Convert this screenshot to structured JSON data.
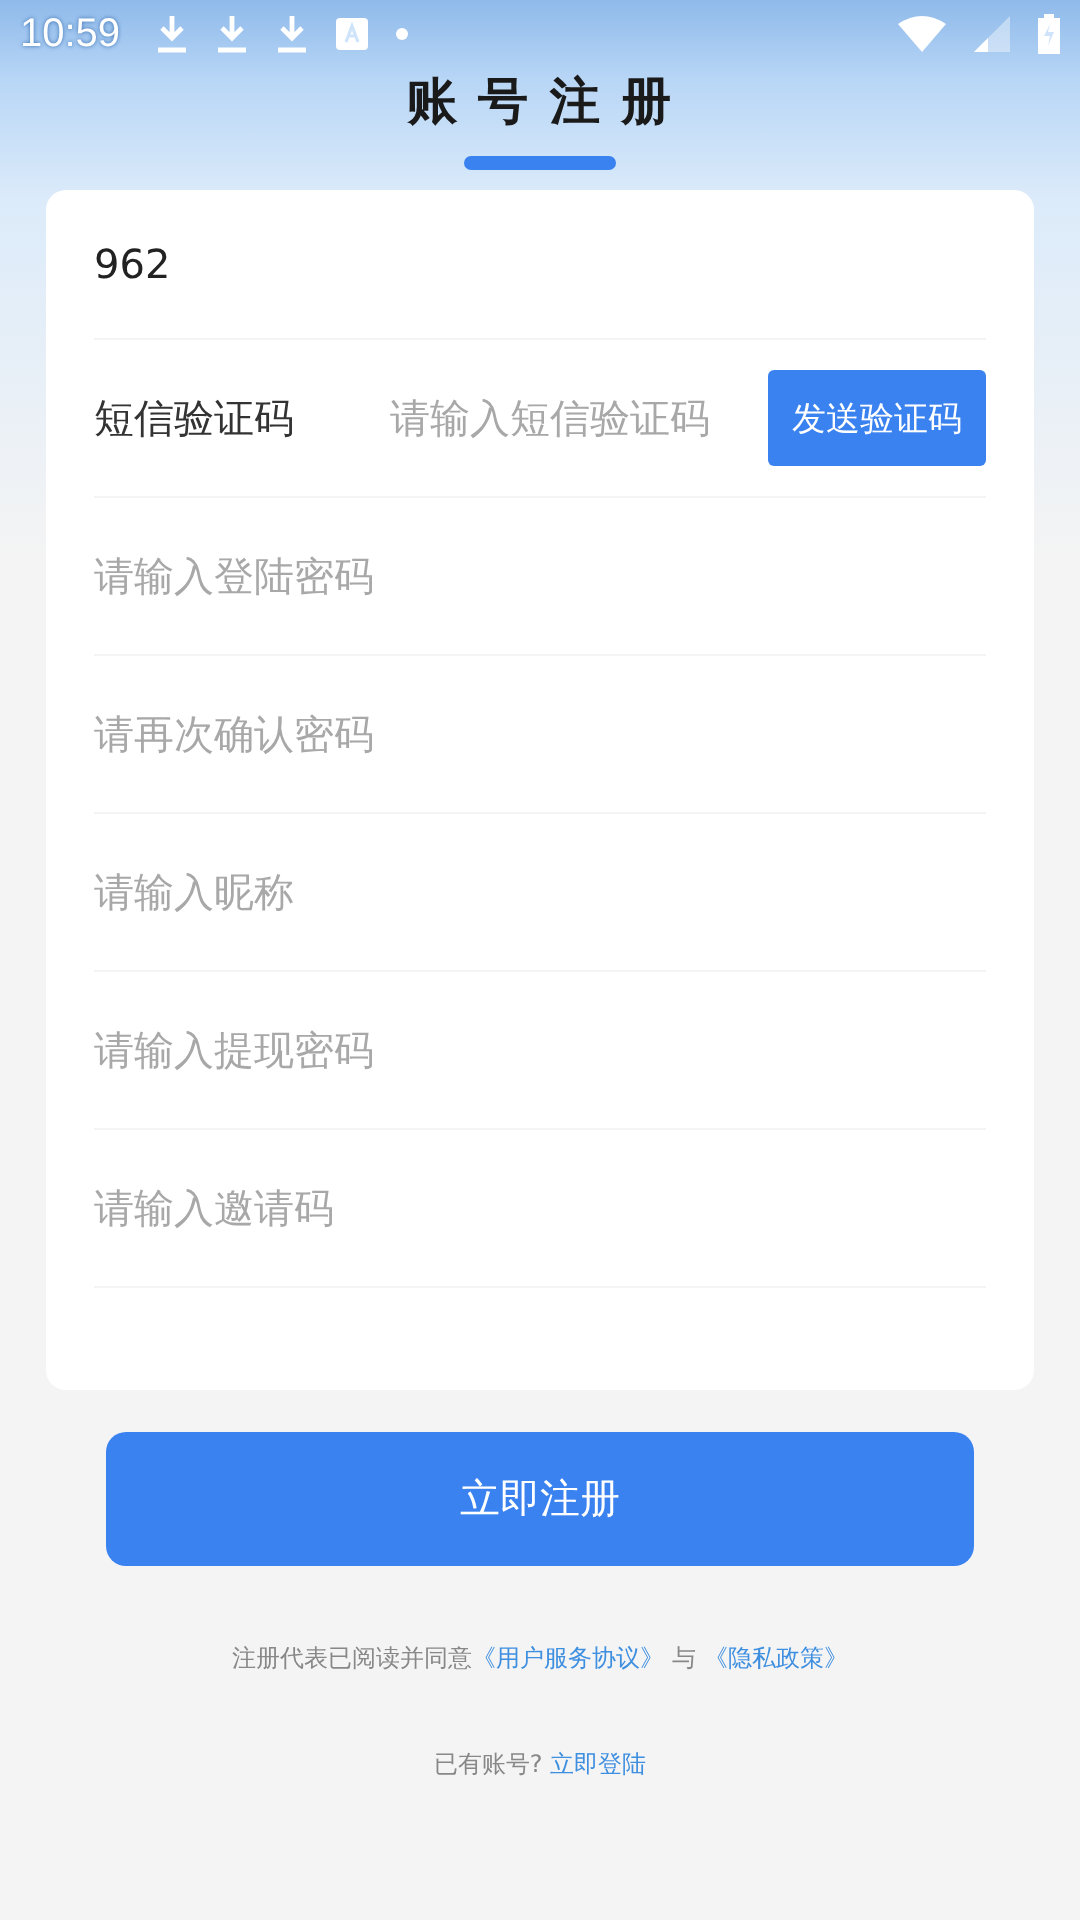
{
  "status_bar": {
    "time": "10:59"
  },
  "header": {
    "title": "账 号 注 册"
  },
  "fields": [
    {
      "kind": "value",
      "value": "962"
    },
    {
      "kind": "code",
      "label": "短信验证码",
      "placeholder": "请输入短信验证码",
      "button": "发送验证码"
    },
    {
      "kind": "input",
      "placeholder": "请输入登陆密码"
    },
    {
      "kind": "input",
      "placeholder": "请再次确认密码"
    },
    {
      "kind": "input",
      "placeholder": "请输入昵称"
    },
    {
      "kind": "input",
      "placeholder": "请输入提现密码"
    },
    {
      "kind": "input",
      "placeholder": "请输入邀请码"
    }
  ],
  "submit_button": "立即注册",
  "agreement": {
    "prefix": "注册代表已阅读并同意",
    "link_1": "《用户服务协议》",
    "joiner": "与",
    "link_2": "《隐私政策》"
  },
  "login_prompt": {
    "text": "已有账号?",
    "link": "立即登陆"
  }
}
